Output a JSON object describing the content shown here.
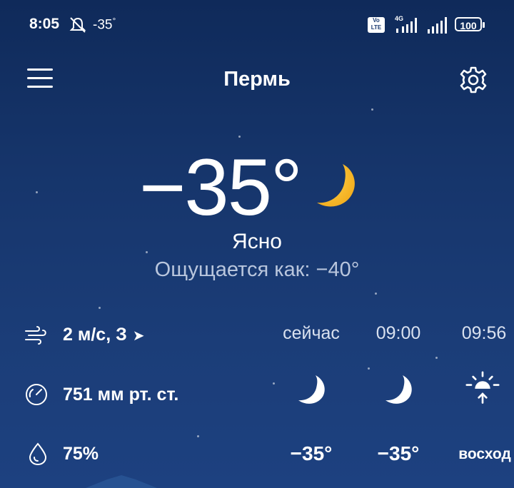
{
  "status_bar": {
    "time": "8:05",
    "weather_temp": "-35",
    "weather_degree": "°",
    "volte": "Vo LTE",
    "network": "4G",
    "battery": "100"
  },
  "header": {
    "city": "Пермь"
  },
  "current": {
    "temperature": "−35°",
    "condition": "Ясно",
    "feels_like": "Ощущается как: −40°"
  },
  "details": {
    "wind": "2 м/с, З",
    "pressure": "751 мм рт. ст.",
    "humidity": "75%"
  },
  "hourly": [
    {
      "time": "сейчас",
      "icon": "moon-icon",
      "temp": "−35°"
    },
    {
      "time": "09:00",
      "icon": "moon-icon",
      "temp": "−35°"
    },
    {
      "time": "09:56",
      "icon": "sunrise-icon",
      "temp": "восход"
    }
  ],
  "colors": {
    "background_top": "#0f2a5a",
    "background_bottom": "#1d4180",
    "moon": "#f6b91c"
  }
}
